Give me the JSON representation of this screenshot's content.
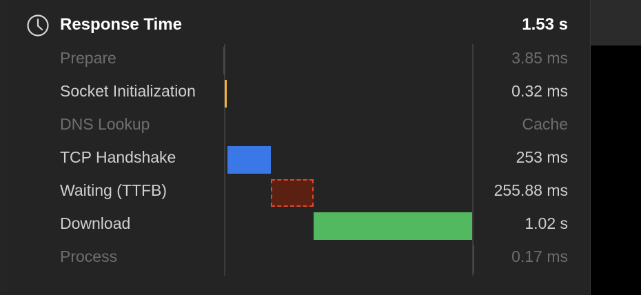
{
  "header": {
    "title": "Response Time",
    "total": "1.53 s",
    "icon": "clock-icon"
  },
  "colors": {
    "socket": "#f0b43c",
    "tcp": "#3b78e7",
    "waiting_fill": "#5a2113",
    "waiting_border": "#e2462e",
    "download": "#52b960",
    "marker": "#4a4a4a"
  },
  "rows": [
    {
      "label": "Prepare",
      "value": "3.85 ms",
      "muted": true
    },
    {
      "label": "Socket Initialization",
      "value": "0.32 ms",
      "muted": false
    },
    {
      "label": "DNS Lookup",
      "value": "Cache",
      "muted": true
    },
    {
      "label": "TCP Handshake",
      "value": "253 ms",
      "muted": false
    },
    {
      "label": "Waiting (TTFB)",
      "value": "255.88 ms",
      "muted": false
    },
    {
      "label": "Download",
      "value": "1.02 s",
      "muted": false
    },
    {
      "label": "Process",
      "value": "0.17 ms",
      "muted": true
    }
  ]
}
